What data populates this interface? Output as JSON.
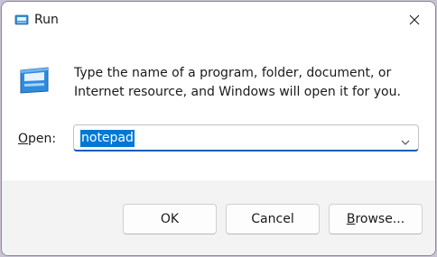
{
  "window": {
    "title": "Run",
    "description": "Type the name of a program, folder, document, or Internet resource, and Windows will open it for you."
  },
  "open_field": {
    "label_prefix": "",
    "label_accesskey": "O",
    "label_rest": "pen:",
    "value": "notepad"
  },
  "buttons": {
    "ok": "OK",
    "cancel": "Cancel",
    "browse_prefix": "",
    "browse_accesskey": "B",
    "browse_rest": "rowse..."
  },
  "icons": {
    "title": "run-icon",
    "app": "run-icon",
    "close": "close-icon",
    "dropdown": "chevron-down-icon"
  },
  "colors": {
    "accent": "#0078d4",
    "selection_text": "#ffffff",
    "footer_bg": "#f3f3f3"
  }
}
